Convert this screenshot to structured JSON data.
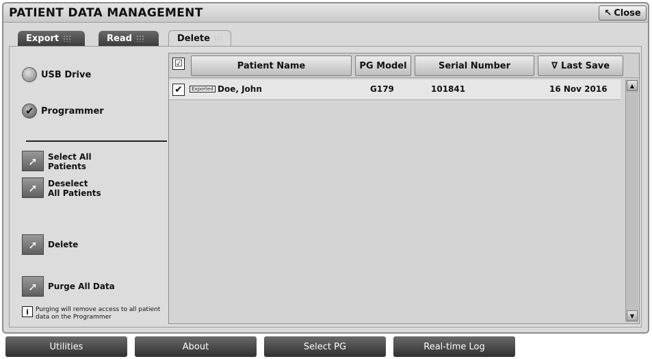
{
  "window": {
    "title": "PATIENT DATA MANAGEMENT",
    "close_label": "Close"
  },
  "tabs": [
    {
      "label": "Export"
    },
    {
      "label": "Read"
    },
    {
      "label": "Delete"
    }
  ],
  "source": {
    "options": [
      {
        "label": "USB Drive",
        "selected": false
      },
      {
        "label": "Programmer",
        "selected": true
      }
    ]
  },
  "actions": {
    "select_all": "Select All Patients",
    "deselect_all": "Deselect All Patients",
    "delete": "Delete",
    "purge_all": "Purge All Data",
    "purge_note": "Purging will remove access to all patient data on the Programmer"
  },
  "table": {
    "columns": {
      "patient_name": "Patient Name",
      "pg_model": "PG Model",
      "serial_number": "Serial Number",
      "last_save": "Last Save",
      "sort_indicator": "∇"
    },
    "rows": [
      {
        "checked": true,
        "badge": "Exported",
        "patient_name": "Doe, John",
        "pg_model": "G179",
        "serial_number": "101841",
        "last_save": "16 Nov 2016"
      }
    ]
  },
  "bottom_bar": {
    "utilities": "Utilities",
    "about": "About",
    "select_pg": "Select PG",
    "realtime_log": "Real-time Log"
  },
  "icons": {
    "close": "cursor-arrow-icon",
    "action": "arrow-right-icon",
    "info": "info-icon"
  }
}
